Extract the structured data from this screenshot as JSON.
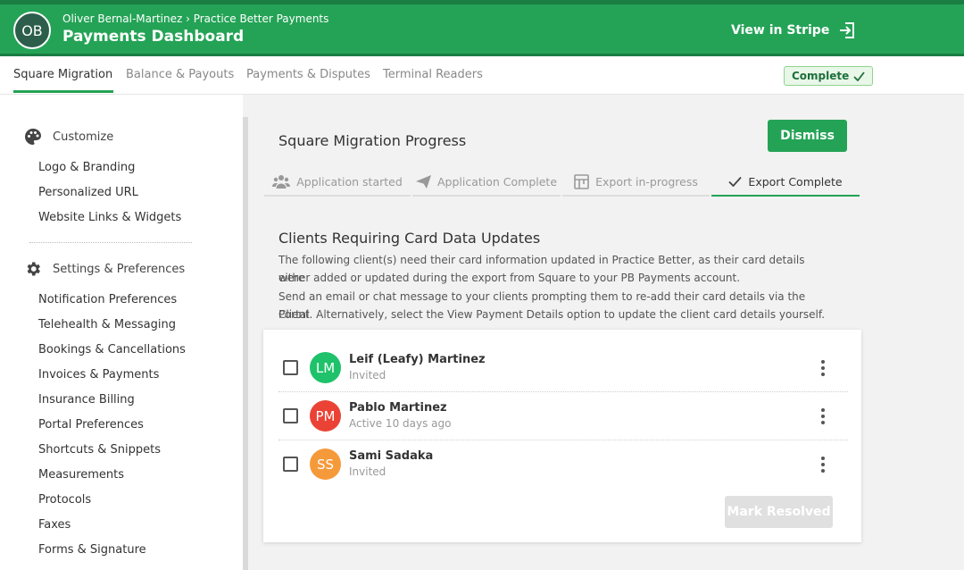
{
  "header": {
    "avatar_initials": "OB",
    "breadcrumb": "Oliver Bernal-Martinez › Practice Better Payments",
    "title": "Payments Dashboard",
    "view_stripe_label": "View in Stripe"
  },
  "tabs": [
    {
      "label": "Square Migration",
      "active": true
    },
    {
      "label": "Balance & Payouts"
    },
    {
      "label": "Payments & Disputes"
    },
    {
      "label": "Terminal Readers"
    }
  ],
  "status_badge": "Complete",
  "sidebar": {
    "customize": {
      "heading": "Customize",
      "icon": "palette-icon",
      "items": [
        "Logo & Branding",
        "Personalized URL",
        "Website Links & Widgets"
      ]
    },
    "settings": {
      "heading": "Settings & Preferences",
      "icon": "gear-icon",
      "items": [
        "Notification Preferences",
        "Telehealth & Messaging",
        "Bookings & Cancellations",
        "Invoices & Payments",
        "Insurance Billing",
        "Portal Preferences",
        "Shortcuts & Snippets",
        "Measurements",
        "Protocols",
        "Faxes",
        "Forms & Signature"
      ]
    }
  },
  "main": {
    "title": "Square Migration Progress",
    "dismiss_label": "Dismiss",
    "steps": [
      {
        "label": "Application started",
        "icon": "people-icon"
      },
      {
        "label": "Application Complete",
        "icon": "send-icon"
      },
      {
        "label": "Export in-progress",
        "icon": "table-icon"
      },
      {
        "label": "Export Complete",
        "icon": "check-icon",
        "active": true
      }
    ],
    "section_title": "Clients Requiring Card Data Updates",
    "description": [
      "The following client(s) need their card information updated in Practice Better, as their card details were",
      "either added or updated during the export from Square to your PB Payments account.",
      "Send an email or chat message to your clients prompting them to re-add their card details via the Client",
      "Portal. Alternatively, select the View Payment Details option to update the client card details yourself."
    ],
    "clients": [
      {
        "initials": "LM",
        "name": "Leif (Leafy) Martinez",
        "status": "Invited",
        "color": "#1fc26a"
      },
      {
        "initials": "PM",
        "name": "Pablo Martinez",
        "status": "Active 10 days ago",
        "color": "#ea4335"
      },
      {
        "initials": "SS",
        "name": "Sami Sadaka",
        "status": "Invited",
        "color": "#f59a3b"
      }
    ],
    "mark_resolved_label": "Mark Resolved"
  },
  "colors": {
    "brand_green": "#24a356",
    "header_dark": "#1a7d42"
  }
}
